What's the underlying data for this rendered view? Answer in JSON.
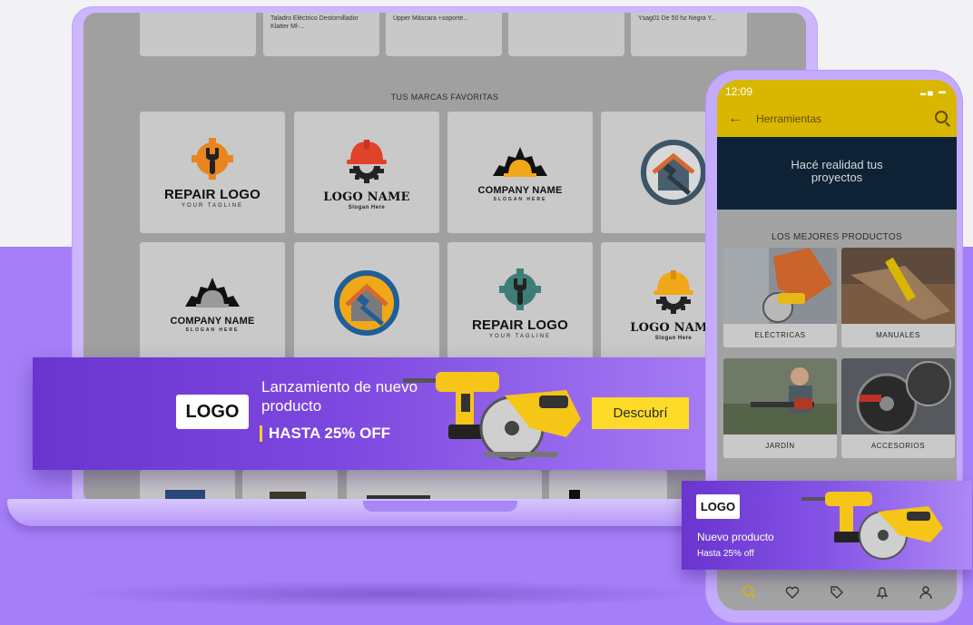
{
  "laptop": {
    "top_products": [
      {
        "name": ""
      },
      {
        "name": "Taladro Eléctrico Destornillador Klatter Ml-..."
      },
      {
        "name": "Upper Máscara +soporte..."
      },
      {
        "name": ""
      },
      {
        "name": "Ysag01 De 50 hz Negra Y..."
      }
    ],
    "brands_title": "TUS MARCAS FAVORITAS",
    "brands": [
      {
        "title": "REPAIR LOGO",
        "subtitle": "YOUR TAGLINE",
        "icon": "gear-wrench-icon"
      },
      {
        "title": "LOGO NAME",
        "subtitle": "Slogan Here",
        "icon": "helmet-gear-icon"
      },
      {
        "title": "COMPANY NAME",
        "subtitle": "SLOGAN HERE",
        "icon": "gear-helmet-icon"
      },
      {
        "title": "",
        "subtitle": "",
        "icon": "house-hammer-icon"
      },
      {
        "title": "COMPANY NAME",
        "subtitle": "SLOGAN HERE",
        "icon": "gear-helmet-icon"
      },
      {
        "title": "",
        "subtitle": "",
        "icon": "house-hammer-icon"
      },
      {
        "title": "REPAIR LOGO",
        "subtitle": "YOUR TAGLINE",
        "icon": "gear-wrench-icon"
      },
      {
        "title": "LOGO NAME",
        "subtitle": "Slogan Here",
        "icon": "helmet-gear-icon"
      }
    ]
  },
  "banner": {
    "logo": "LOGO",
    "title": "Lanzamiento de nuevo producto",
    "discount": "HASTA 25% OFF",
    "cta": "Descubrí"
  },
  "phone": {
    "time": "12:09",
    "status_icons": "signal-battery-icon",
    "appbar_title": "Herramientas",
    "hero_text": "Hacé realidad tus proyectos",
    "section_title": "LOS MEJORES PRODUCTOS",
    "categories": [
      {
        "label": "ELÉCTRICAS"
      },
      {
        "label": "MANUALES"
      },
      {
        "label": "JARDÍN"
      },
      {
        "label": "ACCESORIOS"
      }
    ],
    "nav": [
      "search-icon",
      "heart-icon",
      "tag-icon",
      "bell-icon",
      "user-icon"
    ]
  },
  "phone_banner": {
    "logo": "LOGO",
    "title": "Nuevo producto",
    "subtitle": "Hasta 25% off"
  },
  "colors": {
    "accent_yellow": "#d9b700",
    "purple": "#a57ff7",
    "banner_dark": "#6a34cf",
    "hero_navy": "#0d2235"
  }
}
